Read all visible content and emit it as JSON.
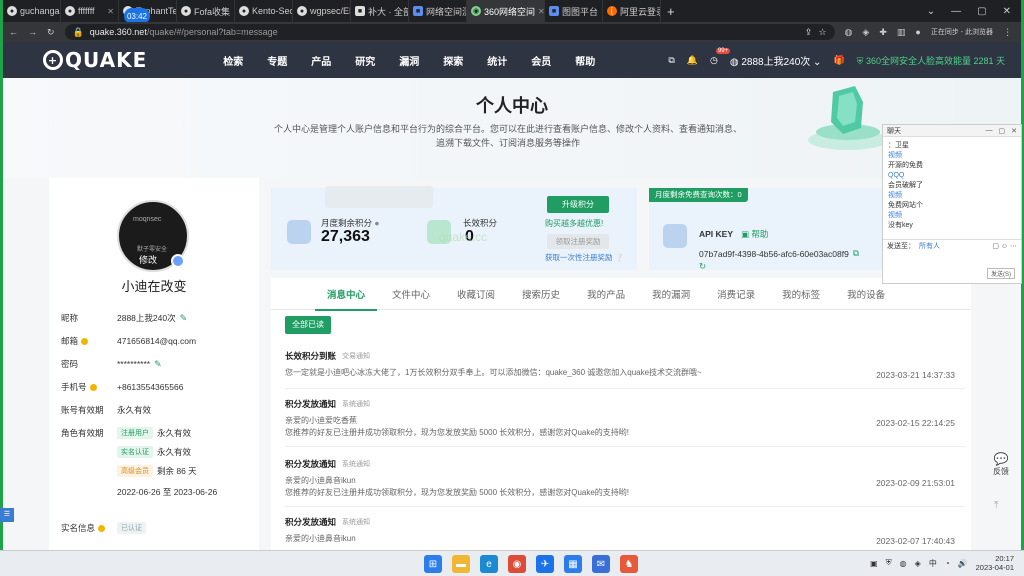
{
  "browser": {
    "tabs": [
      {
        "label": "guchangan",
        "icon": "github-icon"
      },
      {
        "label": "fffffff",
        "icon": "github-icon"
      },
      {
        "label": "TophantTe",
        "icon": "github-icon"
      },
      {
        "label": "Fofa收集",
        "icon": "github-icon"
      },
      {
        "label": "Kento-Sec/",
        "icon": "github-icon"
      },
      {
        "label": "wgpsec/EN",
        "icon": "github-icon"
      },
      {
        "label": "补大 · 全部",
        "icon": "page-icon"
      },
      {
        "label": "网络空间测",
        "icon": "page-icon"
      },
      {
        "label": "360网络空间",
        "icon": "quake-icon"
      },
      {
        "label": "图图平台",
        "icon": "page-icon"
      },
      {
        "label": "阿里云登录",
        "icon": "aliyun-icon"
      }
    ],
    "active_tab_index": 8,
    "recording_time": "03:42",
    "url_host": "quake.360.net",
    "url_path": "/quake/#/personal?tab=message",
    "profile_status": "正在同步 - 此浏览器"
  },
  "site": {
    "logo": "QUAKE",
    "nav": [
      "检索",
      "专题",
      "产品",
      "研究",
      "漏洞",
      "探索",
      "统计",
      "会员",
      "帮助"
    ],
    "user": "2888上我240次",
    "notify_badge": "99+",
    "announcement": "360全网安全人脸高效能量 2281 天"
  },
  "banner": {
    "title": "个人中心",
    "desc_line1": "个人中心是管理个人账户信息和平台行为的综合平台。您可以在此进行查看账户信息、修改个人资料、查看通知消息、",
    "desc_line2": "追溯下载文件、订阅消息服务等操作"
  },
  "profile": {
    "avatar_text1": "moqnsec",
    "avatar_text2": "默子零安全",
    "edit_label": "修改",
    "name": "小迪在改变",
    "rows": {
      "nickname_k": "昵称",
      "nickname_v": "2888上我240次",
      "email_k": "邮箱",
      "email_v": "471656814@qq.com",
      "password_k": "密码",
      "password_v": "**********",
      "phone_k": "手机号",
      "phone_v": "+8613554365566",
      "validity_k": "账号有效期",
      "validity_v": "永久有效",
      "role_k": "角色有效期",
      "role1_tag": "注册用户",
      "role1_v": "永久有效",
      "role2_tag": "实名认证",
      "role2_v": "永久有效",
      "role3_tag": "高级会员",
      "role3_v": "剩余 86 天",
      "role3_range": "2022-06-26 至 2023-06-26",
      "realname_k": "实名信息",
      "realname_tag": "已认证"
    }
  },
  "stats": {
    "monthly_label": "月度剩余积分",
    "monthly_value": "27,363",
    "long_label": "长效积分",
    "long_value": "0",
    "upgrade_btn": "升级积分",
    "buy_link": "购买越多越优惠!",
    "claim_btn": "领取注册奖励",
    "claim_link": "获取一次性注册奖励",
    "query_label": "月度剩余免费查询次数：",
    "query_value": "0",
    "api_label": "API KEY",
    "api_help": "帮助",
    "api_key": "07b7ad9f-4398-4b56-afc6-60e03ac08f9",
    "watermark": "quake.cc"
  },
  "content": {
    "tabs": [
      "消息中心",
      "文件中心",
      "收藏订阅",
      "搜索历史",
      "我的产品",
      "我的漏洞",
      "消费记录",
      "我的标签",
      "我的设备"
    ],
    "read_all": "全部已读",
    "messages": [
      {
        "title": "长效积分到账",
        "type": "交易通知",
        "body": "您一定就是小迪吧心冰冻大佬了，1万长效积分双手奉上。可以添加微信：quake_360 诚邀您加入quake技术交流群哦~",
        "time": "2023-03-21 14:37:33"
      },
      {
        "title": "积分发放通知",
        "type": "系统通知",
        "body": "亲爱的小迪爱吃香蕉\n您推荐的好友已注册并成功领取积分，现为您发放奖励 5000 长效积分，感谢您对Quake的支持哟!",
        "time": "2023-02-15 22:14:25"
      },
      {
        "title": "积分发放通知",
        "type": "系统通知",
        "body": "亲爱的小迪鼻音ikun\n您推荐的好友已注册并成功领取积分，现为您发放奖励 5000 长效积分，感谢您对Quake的支持哟!",
        "time": "2023-02-09 21:53:01"
      },
      {
        "title": "积分发放通知",
        "type": "系统通知",
        "body": "亲爱的小迪鼻音ikun",
        "time": "2023-02-07 17:40:43"
      }
    ]
  },
  "chat": {
    "title": "聊天",
    "lines": [
      {
        "text": "：卫星",
        "nm": false
      },
      {
        "text": "视频",
        "nm": true
      },
      {
        "text": "开源的免费",
        "nm": false
      },
      {
        "text": "QQQ",
        "nm": true
      },
      {
        "text": "会员破解了",
        "nm": false
      },
      {
        "text": "视频",
        "nm": true
      },
      {
        "text": "免费网站个",
        "nm": false
      },
      {
        "text": "视频",
        "nm": true
      },
      {
        "text": "没有key",
        "nm": false
      }
    ],
    "input_label": "发送至：",
    "input_value": "所有人",
    "send": "发送(S)"
  },
  "feedback": "反馈",
  "taskbar": {
    "time": "20:17",
    "date": "2023-04-01",
    "lang": "中"
  }
}
